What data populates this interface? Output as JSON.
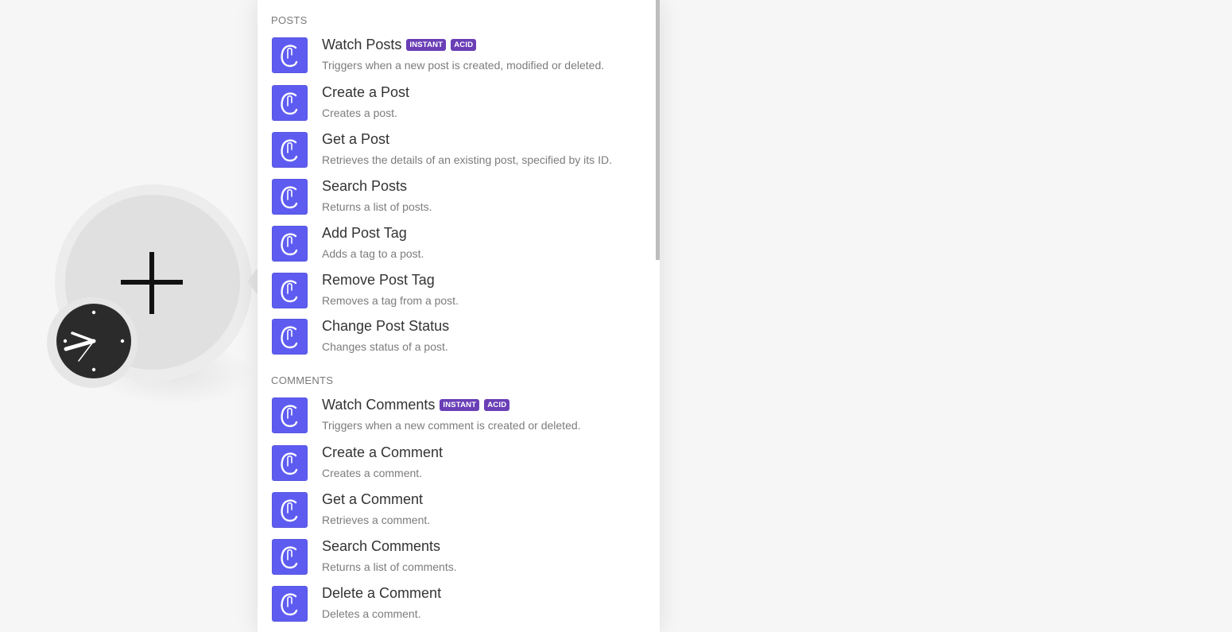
{
  "sections": [
    {
      "header": "POSTS",
      "items": [
        {
          "title": "Watch Posts",
          "description": "Triggers when a new post is created, modified or deleted.",
          "badges": [
            "INSTANT",
            "ACID"
          ]
        },
        {
          "title": "Create a Post",
          "description": "Creates a post.",
          "badges": []
        },
        {
          "title": "Get a Post",
          "description": "Retrieves the details of an existing post, specified by its ID.",
          "badges": []
        },
        {
          "title": "Search Posts",
          "description": "Returns a list of posts.",
          "badges": []
        },
        {
          "title": "Add Post Tag",
          "description": "Adds a tag to a post.",
          "badges": []
        },
        {
          "title": "Remove Post Tag",
          "description": "Removes a tag from a post.",
          "badges": []
        },
        {
          "title": "Change Post Status",
          "description": "Changes status of a post.",
          "badges": []
        }
      ]
    },
    {
      "header": "COMMENTS",
      "items": [
        {
          "title": "Watch Comments",
          "description": "Triggers when a new comment is created or deleted.",
          "badges": [
            "INSTANT",
            "ACID"
          ]
        },
        {
          "title": "Create a Comment",
          "description": "Creates a comment.",
          "badges": []
        },
        {
          "title": "Get a Comment",
          "description": "Retrieves a comment.",
          "badges": []
        },
        {
          "title": "Search Comments",
          "description": "Returns a list of comments.",
          "badges": []
        },
        {
          "title": "Delete a Comment",
          "description": "Deletes a comment.",
          "badges": []
        }
      ]
    }
  ],
  "icons": {
    "app_icon": "app-logo-icon",
    "module_add": "plus-icon",
    "schedule": "clock-icon"
  },
  "colors": {
    "app_icon_bg": "#5e5cf0",
    "badge_bg": "#6a3fb6",
    "canvas_bg": "#f6f6f6"
  }
}
